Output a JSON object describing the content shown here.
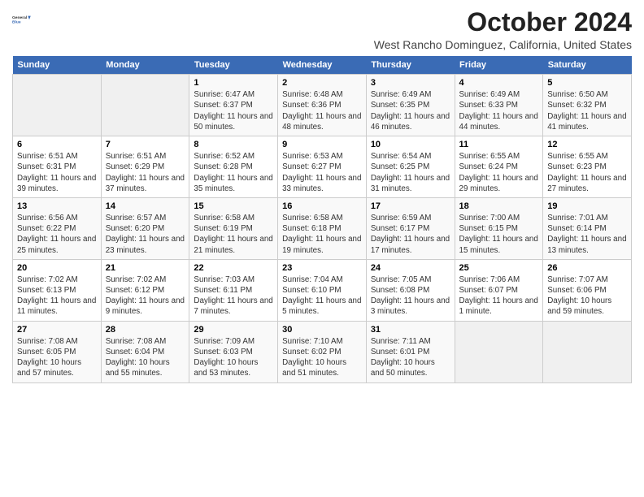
{
  "header": {
    "logo_line1": "General",
    "logo_line2": "Blue",
    "month_title": "October 2024",
    "location": "West Rancho Dominguez, California, United States"
  },
  "days_of_week": [
    "Sunday",
    "Monday",
    "Tuesday",
    "Wednesday",
    "Thursday",
    "Friday",
    "Saturday"
  ],
  "weeks": [
    [
      {
        "day": "",
        "empty": true
      },
      {
        "day": "",
        "empty": true
      },
      {
        "day": "1",
        "rise": "6:47 AM",
        "set": "6:37 PM",
        "daylight": "11 hours and 50 minutes."
      },
      {
        "day": "2",
        "rise": "6:48 AM",
        "set": "6:36 PM",
        "daylight": "11 hours and 48 minutes."
      },
      {
        "day": "3",
        "rise": "6:49 AM",
        "set": "6:35 PM",
        "daylight": "11 hours and 46 minutes."
      },
      {
        "day": "4",
        "rise": "6:49 AM",
        "set": "6:33 PM",
        "daylight": "11 hours and 44 minutes."
      },
      {
        "day": "5",
        "rise": "6:50 AM",
        "set": "6:32 PM",
        "daylight": "11 hours and 41 minutes."
      }
    ],
    [
      {
        "day": "6",
        "rise": "6:51 AM",
        "set": "6:31 PM",
        "daylight": "11 hours and 39 minutes."
      },
      {
        "day": "7",
        "rise": "6:51 AM",
        "set": "6:29 PM",
        "daylight": "11 hours and 37 minutes."
      },
      {
        "day": "8",
        "rise": "6:52 AM",
        "set": "6:28 PM",
        "daylight": "11 hours and 35 minutes."
      },
      {
        "day": "9",
        "rise": "6:53 AM",
        "set": "6:27 PM",
        "daylight": "11 hours and 33 minutes."
      },
      {
        "day": "10",
        "rise": "6:54 AM",
        "set": "6:25 PM",
        "daylight": "11 hours and 31 minutes."
      },
      {
        "day": "11",
        "rise": "6:55 AM",
        "set": "6:24 PM",
        "daylight": "11 hours and 29 minutes."
      },
      {
        "day": "12",
        "rise": "6:55 AM",
        "set": "6:23 PM",
        "daylight": "11 hours and 27 minutes."
      }
    ],
    [
      {
        "day": "13",
        "rise": "6:56 AM",
        "set": "6:22 PM",
        "daylight": "11 hours and 25 minutes."
      },
      {
        "day": "14",
        "rise": "6:57 AM",
        "set": "6:20 PM",
        "daylight": "11 hours and 23 minutes."
      },
      {
        "day": "15",
        "rise": "6:58 AM",
        "set": "6:19 PM",
        "daylight": "11 hours and 21 minutes."
      },
      {
        "day": "16",
        "rise": "6:58 AM",
        "set": "6:18 PM",
        "daylight": "11 hours and 19 minutes."
      },
      {
        "day": "17",
        "rise": "6:59 AM",
        "set": "6:17 PM",
        "daylight": "11 hours and 17 minutes."
      },
      {
        "day": "18",
        "rise": "7:00 AM",
        "set": "6:15 PM",
        "daylight": "11 hours and 15 minutes."
      },
      {
        "day": "19",
        "rise": "7:01 AM",
        "set": "6:14 PM",
        "daylight": "11 hours and 13 minutes."
      }
    ],
    [
      {
        "day": "20",
        "rise": "7:02 AM",
        "set": "6:13 PM",
        "daylight": "11 hours and 11 minutes."
      },
      {
        "day": "21",
        "rise": "7:02 AM",
        "set": "6:12 PM",
        "daylight": "11 hours and 9 minutes."
      },
      {
        "day": "22",
        "rise": "7:03 AM",
        "set": "6:11 PM",
        "daylight": "11 hours and 7 minutes."
      },
      {
        "day": "23",
        "rise": "7:04 AM",
        "set": "6:10 PM",
        "daylight": "11 hours and 5 minutes."
      },
      {
        "day": "24",
        "rise": "7:05 AM",
        "set": "6:08 PM",
        "daylight": "11 hours and 3 minutes."
      },
      {
        "day": "25",
        "rise": "7:06 AM",
        "set": "6:07 PM",
        "daylight": "11 hours and 1 minute."
      },
      {
        "day": "26",
        "rise": "7:07 AM",
        "set": "6:06 PM",
        "daylight": "10 hours and 59 minutes."
      }
    ],
    [
      {
        "day": "27",
        "rise": "7:08 AM",
        "set": "6:05 PM",
        "daylight": "10 hours and 57 minutes."
      },
      {
        "day": "28",
        "rise": "7:08 AM",
        "set": "6:04 PM",
        "daylight": "10 hours and 55 minutes."
      },
      {
        "day": "29",
        "rise": "7:09 AM",
        "set": "6:03 PM",
        "daylight": "10 hours and 53 minutes."
      },
      {
        "day": "30",
        "rise": "7:10 AM",
        "set": "6:02 PM",
        "daylight": "10 hours and 51 minutes."
      },
      {
        "day": "31",
        "rise": "7:11 AM",
        "set": "6:01 PM",
        "daylight": "10 hours and 50 minutes."
      },
      {
        "day": "",
        "empty": true
      },
      {
        "day": "",
        "empty": true
      }
    ]
  ],
  "labels": {
    "sunrise": "Sunrise:",
    "sunset": "Sunset:",
    "daylight": "Daylight:"
  }
}
